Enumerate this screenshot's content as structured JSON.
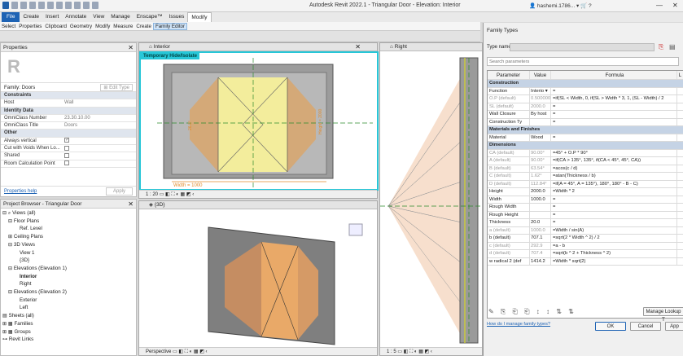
{
  "titlebar": {
    "app_title": "Autodesk Revit 2022.1 - Triangular Door - Elevation: Interior",
    "user": "hashemi.1786...",
    "minimize": "—",
    "close": "✕"
  },
  "ribbon": {
    "tabs": [
      "File",
      "Create",
      "Insert",
      "Annotate",
      "View",
      "Manage",
      "Enscape™",
      "Issues",
      "Modify"
    ],
    "active": "Modify"
  },
  "subribbon": {
    "items": [
      "Select",
      "Properties",
      "Clipboard",
      "Geometry",
      "Modify",
      "Measure",
      "Create"
    ],
    "family_editor": "Family Editor"
  },
  "properties": {
    "title": "Properties",
    "family_selector": "Family: Doors",
    "edit_type": "Edit Type",
    "rows": [
      {
        "k": "Constraints",
        "v": "",
        "sec": true
      },
      {
        "k": "Host",
        "v": "Wall"
      },
      {
        "k": "Identity Data",
        "v": "",
        "sec": true
      },
      {
        "k": "OmniClass Number",
        "v": "23.30.10.00"
      },
      {
        "k": "OmniClass Title",
        "v": "Doors"
      },
      {
        "k": "Other",
        "v": "",
        "sec": true
      },
      {
        "k": "Always vertical",
        "v": "",
        "cb": true,
        "on": true
      },
      {
        "k": "Cut with Voids When Lo...",
        "v": "",
        "cb": true
      },
      {
        "k": "Shared",
        "v": "",
        "cb": true
      },
      {
        "k": "Room Calculation Point",
        "v": "",
        "cb": true
      }
    ],
    "help_link": "Properties help",
    "apply": "Apply"
  },
  "browser": {
    "title": "Project Browser - Triangular Door",
    "items": [
      {
        "t": "⊟ ⌕ Views (all)",
        "i": 0
      },
      {
        "t": "⊟ Floor Plans",
        "i": 1
      },
      {
        "t": "Ref. Level",
        "i": 3
      },
      {
        "t": "⊞ Ceiling Plans",
        "i": 1
      },
      {
        "t": "⊟ 3D Views",
        "i": 1
      },
      {
        "t": "View 1",
        "i": 3
      },
      {
        "t": "{3D}",
        "i": 3
      },
      {
        "t": "⊟ Elevations (Elevation 1)",
        "i": 1
      },
      {
        "t": "Interior",
        "i": 3,
        "b": true
      },
      {
        "t": "Right",
        "i": 3
      },
      {
        "t": "⊟ Elevations (Elevation 2)",
        "i": 1
      },
      {
        "t": "Exterior",
        "i": 3
      },
      {
        "t": "Left",
        "i": 3
      },
      {
        "t": "▤ Sheets (all)",
        "i": 0
      },
      {
        "t": "⊞ ▦ Families",
        "i": 0
      },
      {
        "t": "⊞ ▦ Groups",
        "i": 0
      },
      {
        "t": "⊶ Revit Links",
        "i": 0
      }
    ]
  },
  "views": {
    "interior": {
      "tab": "Interior",
      "banner": "Temporary Hide/Isolate",
      "scale": "1 : 20",
      "dim_width": "Width = 1000",
      "dim_left": "26.0°",
      "dim_right": "Height = 2000"
    },
    "threed": {
      "tab": "{3D}",
      "mode": "Perspective"
    },
    "right": {
      "tab": "Right",
      "scale": "1 : 5"
    }
  },
  "family_types": {
    "title": "Family Types",
    "type_name_label": "Type name:",
    "search_placeholder": "Search parameters",
    "headers": {
      "p": "Parameter",
      "v": "Value",
      "f": "Formula",
      "l": "L"
    },
    "rows": [
      {
        "g": "Construction"
      },
      {
        "p": "Function",
        "v": "Interio ▾",
        "f": "="
      },
      {
        "p": "O.P (default)",
        "v": "0.500000",
        "f": "=if(SL < Width, 0, if(SL > Width * 3, 1, (SL - Width) / 2",
        "d": true
      },
      {
        "p": "SL (default)",
        "v": "2000.0",
        "f": "=",
        "d": true
      },
      {
        "p": "Wall Closure",
        "v": "By host",
        "f": "="
      },
      {
        "p": "Construction Ty",
        "v": "",
        "f": "="
      },
      {
        "g": "Materials and Finishes"
      },
      {
        "p": "Material",
        "v": "Wood",
        "f": "="
      },
      {
        "g": "Dimensions"
      },
      {
        "p": "CA (default)",
        "v": "90.00°",
        "f": "=45° + O.P * 90°",
        "d": true
      },
      {
        "p": "A (default)",
        "v": "90.00°",
        "f": "=if(CA > 135°, 135°, if(CA < 45°, 45°, CA))",
        "d": true
      },
      {
        "p": "B (default)",
        "v": "63.54°",
        "f": "=acos(c / d)",
        "d": true
      },
      {
        "p": "C (default)",
        "v": "1.62°",
        "f": "=atan(Thickness / b)",
        "d": true
      },
      {
        "p": "D (default)",
        "v": "112.84°",
        "f": "=if(A = 45°, A = 135°), 180°, 180° - B - C)",
        "d": true
      },
      {
        "p": "Height",
        "v": "2000.0",
        "f": "=Width * 2"
      },
      {
        "p": "Width",
        "v": "1000.0",
        "f": "="
      },
      {
        "p": "Rough Width",
        "v": "",
        "f": "="
      },
      {
        "p": "Rough Height",
        "v": "",
        "f": "="
      },
      {
        "p": "Thickness",
        "v": "20.0",
        "f": "="
      },
      {
        "p": "a (default)",
        "v": "1000.0",
        "f": "=Width / sin(A)",
        "d": true
      },
      {
        "p": "b (default)",
        "v": "707.1",
        "f": "=sqrt(2 * Width ^ 2) / 2"
      },
      {
        "p": "c (default)",
        "v": "292.9",
        "f": "=a - b",
        "d": true
      },
      {
        "p": "d (default)",
        "v": "707.4",
        "f": "=sqrt(b ^ 2 + Thickness ^ 2)",
        "d": true
      },
      {
        "p": "w radical 2 (def",
        "v": "1414.2",
        "f": "=Width * sqrt(2)"
      }
    ],
    "manage_lookup": "Manage Lookup T",
    "help_link": "How do I manage family types?",
    "ok": "OK",
    "cancel": "Cancel",
    "apply": "App"
  }
}
